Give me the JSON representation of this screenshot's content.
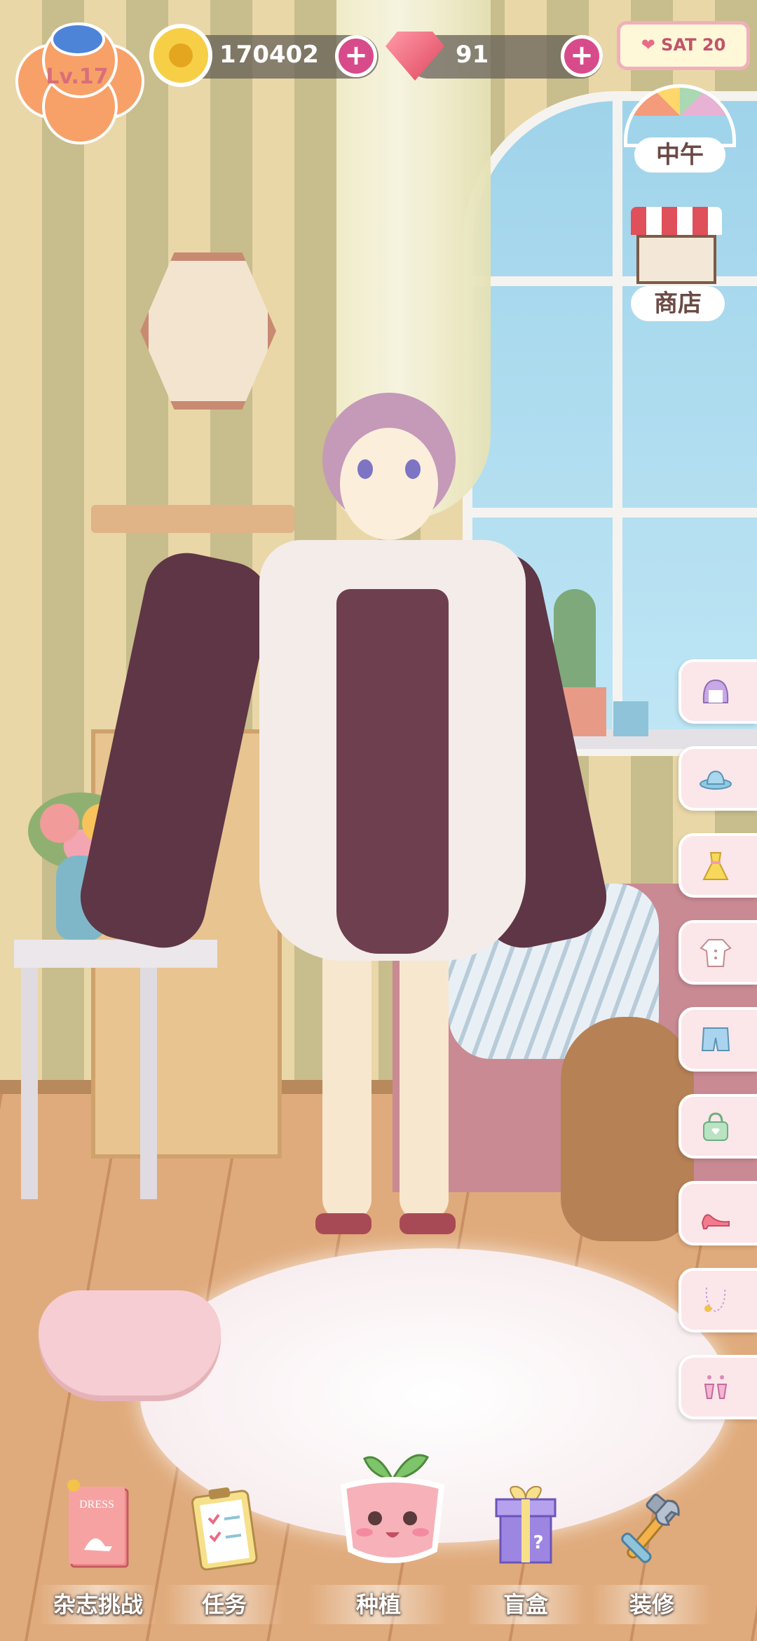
{
  "hud": {
    "level": "Lv.17",
    "coins": "170402",
    "gems": "91",
    "plus": "+",
    "date": "SAT 20",
    "date_heart": "❤",
    "time_of_day": "中午",
    "shop": "商店"
  },
  "wardrobe_tabs": [
    {
      "icon": "hair-icon"
    },
    {
      "icon": "hat-icon"
    },
    {
      "icon": "dress-icon"
    },
    {
      "icon": "top-icon"
    },
    {
      "icon": "shorts-icon"
    },
    {
      "icon": "bag-icon"
    },
    {
      "icon": "shoe-icon"
    },
    {
      "icon": "necklace-icon"
    },
    {
      "icon": "earring-icon"
    }
  ],
  "bottom_nav": [
    {
      "label": "杂志挑战",
      "icon": "magazine-icon",
      "icon_text": "DRESS"
    },
    {
      "label": "任务",
      "icon": "clipboard-icon"
    },
    {
      "label": "种植",
      "icon": "plant-pot-icon"
    },
    {
      "label": "盲盒",
      "icon": "gift-box-icon",
      "icon_text": "?"
    },
    {
      "label": "装修",
      "icon": "tools-icon"
    }
  ],
  "colors": {
    "accent": "#d84b8a",
    "tab_bg": "#fbe6ea",
    "level_badge": "#f7a169"
  }
}
